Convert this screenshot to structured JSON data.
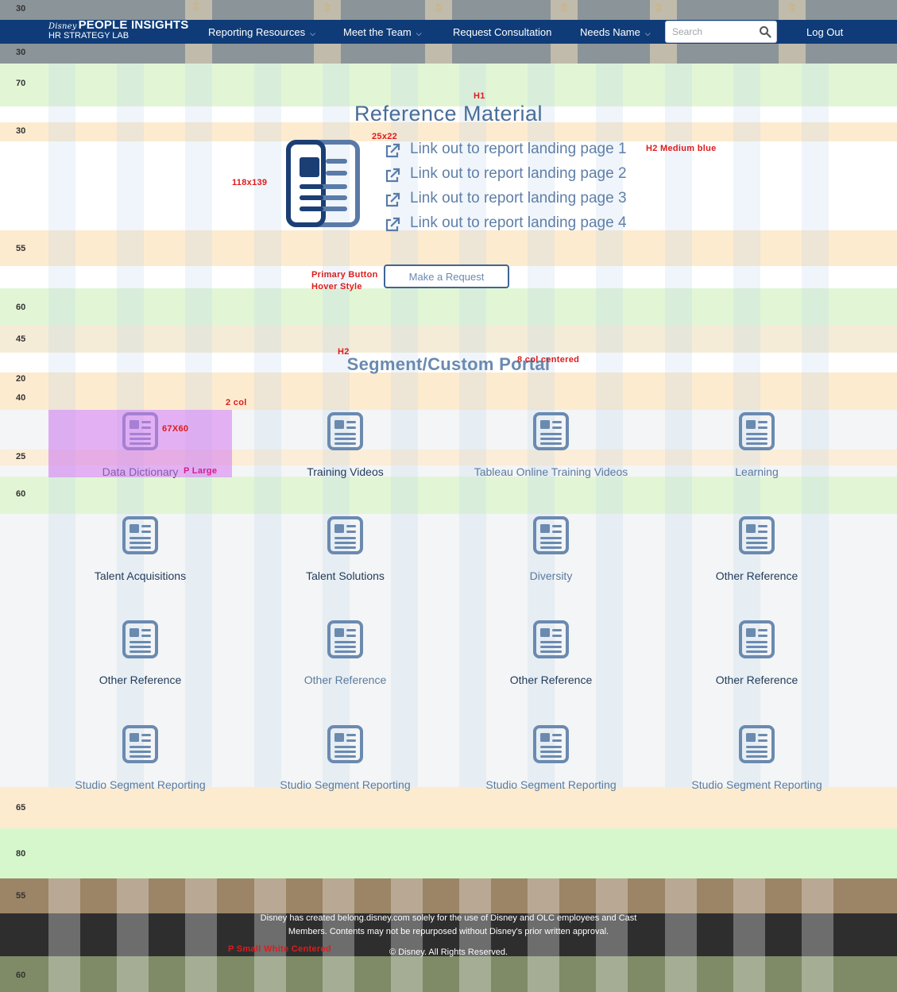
{
  "nav": {
    "logo_sub": "Disney",
    "logo_main": "PEOPLE INSIGHTS",
    "logo_tag": "HR STRATEGY LAB",
    "items": [
      {
        "label": "Reporting Resources",
        "dropdown": true
      },
      {
        "label": "Meet the Team",
        "dropdown": true
      },
      {
        "label": "Request Consultation",
        "dropdown": false
      },
      {
        "label": "Needs Name",
        "dropdown": true
      }
    ],
    "search_placeholder": "Search",
    "logout_label": "Log Out",
    "bar_color": "#0f3c78"
  },
  "spacing_labels": [
    "30",
    "30",
    "70",
    "30",
    "55",
    "60",
    "45",
    "20",
    "40",
    "25",
    "60",
    "65",
    "80",
    "55",
    "60"
  ],
  "nav_guide_labels": [
    "40",
    "45",
    "45",
    "45",
    "20",
    "45"
  ],
  "reference": {
    "title": "Reference Material",
    "links": [
      "Link out to report landing page 1",
      "Link out to report landing page 2",
      "Link out to report landing page 3",
      "Link out to report landing page 4"
    ],
    "button_label": "Make a Request"
  },
  "portal": {
    "title": "Segment/Custom Portal",
    "cards": [
      {
        "label": "Data Dictionary",
        "tone": "dark"
      },
      {
        "label": "Training Videos",
        "tone": "dark"
      },
      {
        "label": "Tableau Online Training Videos",
        "tone": "light"
      },
      {
        "label": "Learning",
        "tone": "light"
      },
      {
        "label": "Talent Acquisitions",
        "tone": "dark"
      },
      {
        "label": "Talent Solutions",
        "tone": "dark"
      },
      {
        "label": "Diversity",
        "tone": "light"
      },
      {
        "label": "Other Reference",
        "tone": "dark"
      },
      {
        "label": "Other Reference",
        "tone": "dark"
      },
      {
        "label": "Other Reference",
        "tone": "light"
      },
      {
        "label": "Other Reference",
        "tone": "dark"
      },
      {
        "label": "Other Reference",
        "tone": "dark"
      },
      {
        "label": "Studio Segment Reporting",
        "tone": "light"
      },
      {
        "label": "Studio Segment Reporting",
        "tone": "light"
      },
      {
        "label": "Studio Segment Reporting",
        "tone": "light"
      },
      {
        "label": "Studio Segment Reporting",
        "tone": "light"
      }
    ]
  },
  "annotations": {
    "h1": "H1",
    "icon_size_small": "25x22",
    "h2_medium_blue": "H2 Medium blue",
    "icon_size_big": "118x139",
    "primary_button_1": "Primary Button",
    "primary_button_2": "Hover Style",
    "h2": "H2",
    "eight_col": "8 col centered",
    "two_col": "2 col",
    "icon_size_card": "67X60",
    "p_large": "P Large",
    "p_small": "P Small White Centered"
  },
  "footer": {
    "line1": "Disney has created belong.disney.com solely for the use of Disney and OLC employees and Cast",
    "line2": "Members. Contents may not be repurposed without Disney's prior written approval.",
    "copyright": "© Disney. All Rights Reserved."
  },
  "colors": {
    "heading": "#4a6d99",
    "link": "#5f7fa8",
    "icon": "#6a8ab0",
    "annotation": "#e01b1b"
  }
}
